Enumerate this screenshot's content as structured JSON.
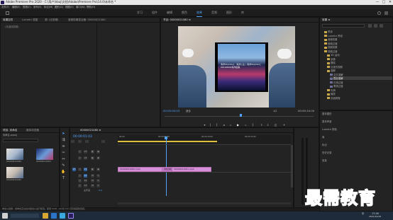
{
  "window": {
    "title": "Adobe Premiere Pro 2020 - C:\\用户\\hboj\\文档\\Adobe\\Premiere Pro\\14.0\\未命名 *",
    "controls": [
      "—",
      "□",
      "✕"
    ]
  },
  "menubar": [
    "文件(F)",
    "编辑(E)",
    "剪辑(C)",
    "序列(S)",
    "标记(M)",
    "图形(G)",
    "视图(V)",
    "窗口(W)",
    "帮助(H)"
  ],
  "workspace_tabs": [
    {
      "label": "学习",
      "active": false
    },
    {
      "label": "组件",
      "active": false
    },
    {
      "label": "编辑",
      "active": false
    },
    {
      "label": "颜色",
      "active": false
    },
    {
      "label": "效果",
      "active": true
    },
    {
      "label": "音频",
      "active": false
    },
    {
      "label": "图形",
      "active": false
    },
    {
      "label": "库",
      "active": false
    }
  ],
  "source_panel": {
    "tabs": [
      "效果控件",
      "Lumetri 范围",
      "源: (无剪辑)",
      "音频剪辑混合器: 00000021080",
      "00"
    ],
    "empty_message": "(未选择剪辑)"
  },
  "program_monitor": {
    "tab": "节目: 00000021080 ≡",
    "phone_text": "海洋SS(Intro)：海洋公主 | 海洋SS(Intro)：00100000海洋最美",
    "timecode_left": "00:00:00:03",
    "fit": "适合",
    "scale": "1/2",
    "timecode_right": "00:00:10:00"
  },
  "effects_panel": {
    "tab": "效果 ≡",
    "search_placeholder": "",
    "items": [
      {
        "label": "预设",
        "indent": 1,
        "selected": false
      },
      {
        "label": "Lumetri 预设",
        "indent": 1,
        "selected": false
      },
      {
        "label": "音频效果",
        "indent": 1,
        "selected": false
      },
      {
        "label": "音频过渡",
        "indent": 1,
        "selected": false
      },
      {
        "label": "视频效果",
        "indent": 1,
        "selected": false
      },
      {
        "label": "视频过渡",
        "indent": 1,
        "selected": false
      },
      {
        "label": "3D 运动",
        "indent": 2,
        "selected": false
      },
      {
        "label": "划像",
        "indent": 2,
        "selected": false
      },
      {
        "label": "擦除",
        "indent": 2,
        "selected": false
      },
      {
        "label": "沉浸式视频",
        "indent": 2,
        "selected": false
      },
      {
        "label": "溶解",
        "indent": 2,
        "selected": false
      },
      {
        "label": "交叉溶解",
        "indent": 3,
        "selected": false
      },
      {
        "label": "叠加溶解",
        "indent": 3,
        "selected": true
      },
      {
        "label": "白场过渡",
        "indent": 3,
        "selected": false
      },
      {
        "label": "黑场过渡",
        "indent": 3,
        "selected": false
      },
      {
        "label": "内滑",
        "indent": 2,
        "selected": false
      },
      {
        "label": "缩放",
        "indent": 2,
        "selected": false
      },
      {
        "label": "页面剥落",
        "indent": 2,
        "selected": false
      }
    ],
    "subpanels": [
      "基本图形",
      "基本声音",
      "Lumetri 颜色",
      "库",
      "标记",
      "历史记录",
      "信息"
    ]
  },
  "project_panel": {
    "tabs": [
      "项目: 未命名",
      "媒体浏览器"
    ],
    "file": "未命名.prproj",
    "search_placeholder": "",
    "items": [
      "00000021080",
      "00000021081",
      "00000021082"
    ]
  },
  "timeline": {
    "tab": "00000021080 ≡",
    "timecode": "00:00:01:03",
    "ruler": [
      "00:00",
      "00:00:05:00",
      "00:00:10:00",
      "00:00:15:00",
      "00:00:20:00"
    ],
    "tracks": [
      {
        "name": "V3",
        "label": "V3"
      },
      {
        "name": "V2",
        "label": "V2"
      },
      {
        "name": "V1",
        "label": "V1"
      },
      {
        "name": "A1",
        "label": "A1"
      },
      {
        "name": "A2",
        "label": "A2"
      },
      {
        "name": "A3",
        "label": "A3"
      }
    ],
    "master": {
      "label": "主声道",
      "value": "0.0"
    },
    "clips": [
      {
        "label": "00000021080.mp4",
        "track": "V1"
      },
      {
        "label": "叠加溶解",
        "track": "V1"
      },
      {
        "label": "00000021081.mp4",
        "track": "V1"
      }
    ]
  },
  "statusbar": {
    "text": "单击以选择，或单击空白处并拖动以进行框选。使用 Shift、Alt 和 Ctrl 可获得其他选项。"
  },
  "taskbar": {
    "time": "17:26",
    "date": "2021/10/15",
    "ime": "中"
  },
  "watermark": "最需教育",
  "colors": {
    "accent": "#4fa3ff",
    "clip": "#d78fd8",
    "watermark": "#1f5cd0"
  }
}
